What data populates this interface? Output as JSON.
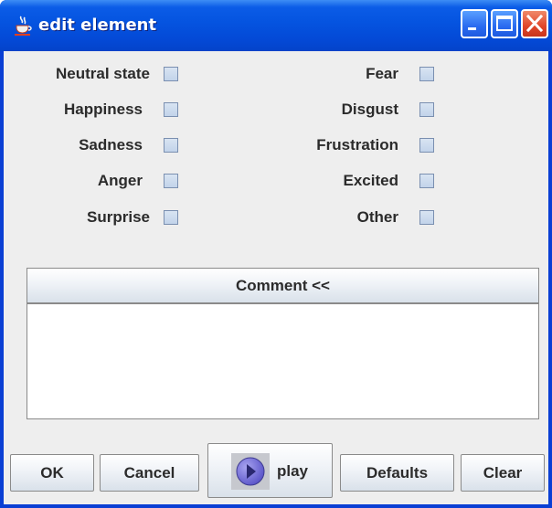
{
  "window": {
    "title": "edit element",
    "icon": "java-cup-icon",
    "controls": [
      "minimize-icon",
      "maximize-icon",
      "close-icon"
    ]
  },
  "emotions": {
    "left": [
      {
        "label": "Neutral state",
        "checked": false
      },
      {
        "label": "Happiness",
        "checked": false
      },
      {
        "label": "Sadness",
        "checked": false
      },
      {
        "label": "Anger",
        "checked": false
      },
      {
        "label": "Surprise",
        "checked": false
      }
    ],
    "right": [
      {
        "label": "Fear",
        "checked": false
      },
      {
        "label": "Disgust",
        "checked": false
      },
      {
        "label": "Frustration",
        "checked": false
      },
      {
        "label": "Excited",
        "checked": false
      },
      {
        "label": "Other",
        "checked": false
      }
    ]
  },
  "comment": {
    "toggle_label": "Comment <<",
    "value": ""
  },
  "buttons": {
    "ok": "OK",
    "cancel": "Cancel",
    "play": "play",
    "defaults": "Defaults",
    "clear": "Clear"
  },
  "colors": {
    "titlebar": "#0554e0",
    "panel": "#eeeeee",
    "checkbox": "#c8d7ec",
    "close": "#e0462a"
  }
}
